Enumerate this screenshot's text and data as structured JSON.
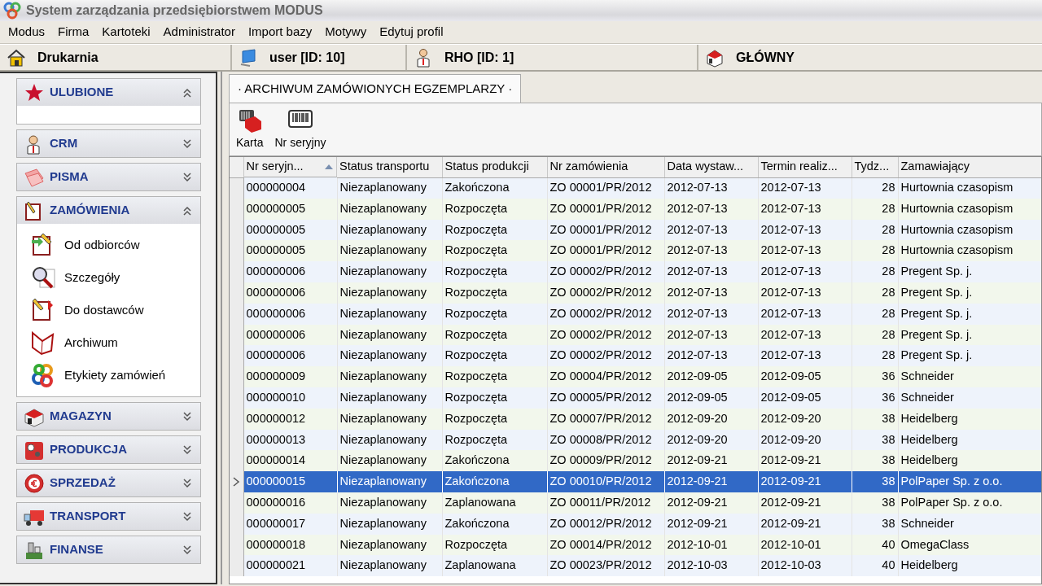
{
  "window": {
    "title": "System zarządzania przedsiębiorstwem MODUS"
  },
  "menu": [
    "Modus",
    "Firma",
    "Kartoteki",
    "Administrator",
    "Import bazy",
    "Motywy",
    "Edytuj profil"
  ],
  "status_bar": [
    {
      "kind": "home",
      "text": "Drukarnia"
    },
    {
      "kind": "user",
      "text": "user [ID: 10]"
    },
    {
      "kind": "person",
      "text": "RHO [ID: 1]"
    },
    {
      "kind": "store",
      "text": "GŁÓWNY"
    }
  ],
  "sidebar": {
    "groups": [
      {
        "label": "ULUBIONE",
        "expanded": true
      },
      {
        "label": "CRM",
        "expanded": false
      },
      {
        "label": "PISMA",
        "expanded": false
      },
      {
        "label": "ZAMÓWIENIA",
        "expanded": true,
        "items": [
          "Od odbiorców",
          "Szczegóły",
          "Do dostawców",
          "Archiwum",
          "Etykiety zamówień"
        ]
      },
      {
        "label": "MAGAZYN",
        "expanded": false
      },
      {
        "label": "PRODUKCJA",
        "expanded": false
      },
      {
        "label": "SPRZEDAŻ",
        "expanded": false
      },
      {
        "label": "TRANSPORT",
        "expanded": false
      },
      {
        "label": "FINANSE",
        "expanded": false
      }
    ]
  },
  "tabs": [
    {
      "label": "· ARCHIWUM ZAMÓWIONYCH EGZEMPLARZY ·",
      "selected": true
    }
  ],
  "toolbar": [
    "Karta",
    "Nr seryjny"
  ],
  "table": {
    "columns": [
      {
        "label": "Nr seryjn...",
        "sorted": true
      },
      {
        "label": "Status transportu",
        "sorted": false
      },
      {
        "label": "Status produkcji",
        "sorted": false
      },
      {
        "label": "Nr zamówienia",
        "sorted": false
      },
      {
        "label": "Data wystaw...",
        "sorted": false
      },
      {
        "label": "Termin realiz...",
        "sorted": false
      },
      {
        "label": "Tydz...",
        "sorted": false
      },
      {
        "label": "Zamawiający",
        "sorted": false
      }
    ],
    "rows": [
      {
        "cells": [
          "000000004",
          "Niezaplanowany",
          "Zakończona",
          "ZO 00001/PR/2012",
          "2012-07-13",
          "2012-07-13",
          "28",
          "Hurtownia czasopism"
        ],
        "selected": false
      },
      {
        "cells": [
          "000000005",
          "Niezaplanowany",
          "Rozpoczęta",
          "ZO 00001/PR/2012",
          "2012-07-13",
          "2012-07-13",
          "28",
          "Hurtownia czasopism"
        ],
        "selected": false
      },
      {
        "cells": [
          "000000005",
          "Niezaplanowany",
          "Rozpoczęta",
          "ZO 00001/PR/2012",
          "2012-07-13",
          "2012-07-13",
          "28",
          "Hurtownia czasopism"
        ],
        "selected": false
      },
      {
        "cells": [
          "000000005",
          "Niezaplanowany",
          "Rozpoczęta",
          "ZO 00001/PR/2012",
          "2012-07-13",
          "2012-07-13",
          "28",
          "Hurtownia czasopism"
        ],
        "selected": false
      },
      {
        "cells": [
          "000000006",
          "Niezaplanowany",
          "Rozpoczęta",
          "ZO 00002/PR/2012",
          "2012-07-13",
          "2012-07-13",
          "28",
          "Pregent Sp. j."
        ],
        "selected": false
      },
      {
        "cells": [
          "000000006",
          "Niezaplanowany",
          "Rozpoczęta",
          "ZO 00002/PR/2012",
          "2012-07-13",
          "2012-07-13",
          "28",
          "Pregent Sp. j."
        ],
        "selected": false
      },
      {
        "cells": [
          "000000006",
          "Niezaplanowany",
          "Rozpoczęta",
          "ZO 00002/PR/2012",
          "2012-07-13",
          "2012-07-13",
          "28",
          "Pregent Sp. j."
        ],
        "selected": false
      },
      {
        "cells": [
          "000000006",
          "Niezaplanowany",
          "Rozpoczęta",
          "ZO 00002/PR/2012",
          "2012-07-13",
          "2012-07-13",
          "28",
          "Pregent Sp. j."
        ],
        "selected": false
      },
      {
        "cells": [
          "000000006",
          "Niezaplanowany",
          "Rozpoczęta",
          "ZO 00002/PR/2012",
          "2012-07-13",
          "2012-07-13",
          "28",
          "Pregent Sp. j."
        ],
        "selected": false
      },
      {
        "cells": [
          "000000009",
          "Niezaplanowany",
          "Rozpoczęta",
          "ZO 00004/PR/2012",
          "2012-09-05",
          "2012-09-05",
          "36",
          "Schneider"
        ],
        "selected": false
      },
      {
        "cells": [
          "000000010",
          "Niezaplanowany",
          "Rozpoczęta",
          "ZO 00005/PR/2012",
          "2012-09-05",
          "2012-09-05",
          "36",
          "Schneider"
        ],
        "selected": false
      },
      {
        "cells": [
          "000000012",
          "Niezaplanowany",
          "Rozpoczęta",
          "ZO 00007/PR/2012",
          "2012-09-20",
          "2012-09-20",
          "38",
          "Heidelberg"
        ],
        "selected": false
      },
      {
        "cells": [
          "000000013",
          "Niezaplanowany",
          "Rozpoczęta",
          "ZO 00008/PR/2012",
          "2012-09-20",
          "2012-09-20",
          "38",
          "Heidelberg"
        ],
        "selected": false
      },
      {
        "cells": [
          "000000014",
          "Niezaplanowany",
          "Zakończona",
          "ZO 00009/PR/2012",
          "2012-09-21",
          "2012-09-21",
          "38",
          "Heidelberg"
        ],
        "selected": false
      },
      {
        "cells": [
          "000000015",
          "Niezaplanowany",
          "Zakończona",
          "ZO 00010/PR/2012",
          "2012-09-21",
          "2012-09-21",
          "38",
          "PolPaper Sp. z o.o."
        ],
        "selected": true
      },
      {
        "cells": [
          "000000016",
          "Niezaplanowany",
          "Zaplanowana",
          "ZO 00011/PR/2012",
          "2012-09-21",
          "2012-09-21",
          "38",
          "PolPaper Sp. z o.o."
        ],
        "selected": false
      },
      {
        "cells": [
          "000000017",
          "Niezaplanowany",
          "Zakończona",
          "ZO 00012/PR/2012",
          "2012-09-21",
          "2012-09-21",
          "38",
          "Schneider"
        ],
        "selected": false
      },
      {
        "cells": [
          "000000018",
          "Niezaplanowany",
          "Rozpoczęta",
          "ZO 00014/PR/2012",
          "2012-10-01",
          "2012-10-01",
          "40",
          "OmegaClass"
        ],
        "selected": false
      },
      {
        "cells": [
          "000000021",
          "Niezaplanowany",
          "Zaplanowana",
          "ZO 00023/PR/2012",
          "2012-10-03",
          "2012-10-03",
          "40",
          "Heidelberg"
        ],
        "selected": false
      }
    ]
  }
}
